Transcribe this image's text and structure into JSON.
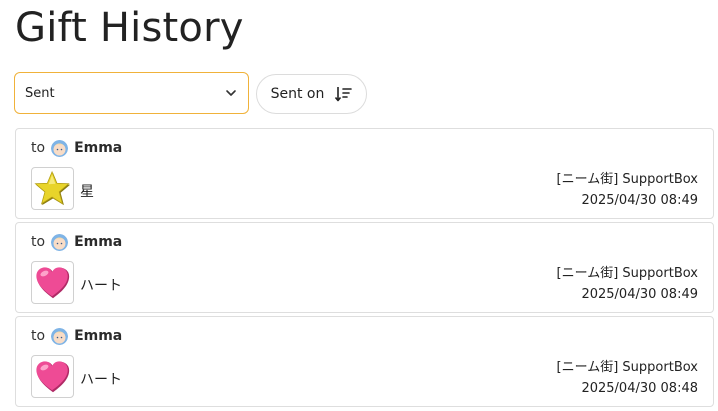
{
  "page": {
    "title": "Gift History"
  },
  "filter": {
    "selected": "Sent"
  },
  "sort": {
    "label": "Sent on"
  },
  "colors": {
    "accent_border": "#f0b23a",
    "card_border": "#dedede"
  },
  "gifts": [
    {
      "to_word": "to",
      "recipient": "Emma",
      "gift_icon": "star-icon",
      "gift_name": "星",
      "source": "[ニーム街] SupportBox",
      "timestamp": "2025/04/30 08:49"
    },
    {
      "to_word": "to",
      "recipient": "Emma",
      "gift_icon": "heart-icon",
      "gift_name": "ハート",
      "source": "[ニーム街] SupportBox",
      "timestamp": "2025/04/30 08:49"
    },
    {
      "to_word": "to",
      "recipient": "Emma",
      "gift_icon": "heart-icon",
      "gift_name": "ハート",
      "source": "[ニーム街] SupportBox",
      "timestamp": "2025/04/30 08:48"
    }
  ]
}
